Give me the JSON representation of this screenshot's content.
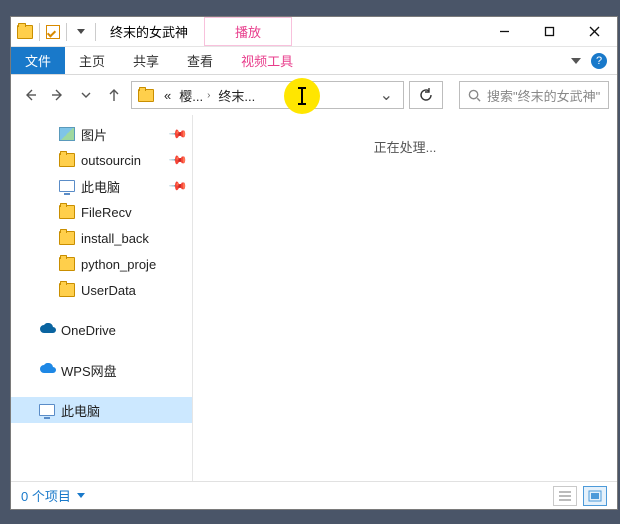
{
  "window": {
    "title": "终末的女武神",
    "ribbon_context_title": "播放",
    "min_tooltip": "Minimize",
    "max_tooltip": "Maximize",
    "close_tooltip": "Close"
  },
  "ribbon": {
    "file": "文件",
    "home": "主页",
    "share": "共享",
    "view": "查看",
    "context_tab": "视频工具",
    "help": "?"
  },
  "nav": {
    "back": "←",
    "crumb_prefix": "«",
    "crumb1": "樱...",
    "crumb_sep": "›",
    "crumb2": "终末...",
    "dropdown": "⌄",
    "refresh": "↻"
  },
  "search": {
    "placeholder": "搜索\"终末的女武神\""
  },
  "tree": {
    "items": [
      {
        "label": "图片",
        "icon": "pic",
        "pinned": true,
        "level": 2
      },
      {
        "label": "outsourcin",
        "icon": "fold",
        "pinned": true,
        "level": 2
      },
      {
        "label": "此电脑",
        "icon": "pc",
        "pinned": true,
        "level": 2
      },
      {
        "label": "FileRecv",
        "icon": "fold",
        "pinned": false,
        "level": 2
      },
      {
        "label": "install_back",
        "icon": "fold",
        "pinned": false,
        "level": 2
      },
      {
        "label": "python_proje",
        "icon": "fold",
        "pinned": false,
        "level": 2
      },
      {
        "label": "UserData",
        "icon": "fold",
        "pinned": false,
        "level": 2
      }
    ],
    "onedrive": "OneDrive",
    "wps": "WPS网盘",
    "thispc": "此电脑"
  },
  "content": {
    "loading": "正在处理..."
  },
  "status": {
    "items": "0 个项目"
  },
  "colors": {
    "accent": "#1979ca",
    "context_pink": "#e83e8c",
    "highlight": "#ffe600"
  }
}
